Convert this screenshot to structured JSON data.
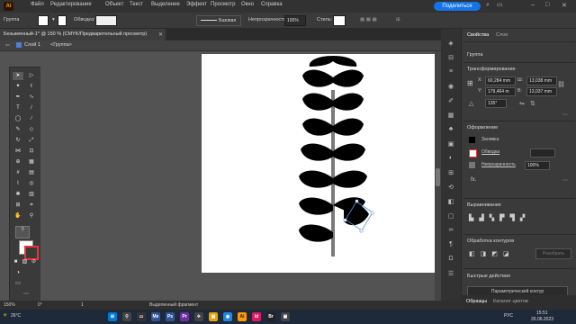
{
  "menubar": {
    "items": [
      "Файл",
      "Редактирование",
      "Объект",
      "Текст",
      "Выделение",
      "Эффект",
      "Просмотр",
      "Окно",
      "Справка"
    ],
    "share_label": "Поделиться"
  },
  "control_bar": {
    "selection_label": "Группа",
    "stroke_label": "Обводка:",
    "stroke_style": "Базовая",
    "opacity_label": "Непрозрачность:",
    "opacity_value": "100%",
    "style_label": "Стиль:"
  },
  "document": {
    "tab_title": "Безымянный-1* @ 150 % (CMYK/Предварительный просмотр)",
    "breadcrumb_layer": "Слой 1",
    "breadcrumb_group": "<Группа>"
  },
  "panel": {
    "tabs": [
      "Свойства",
      "Слои"
    ],
    "selection_type": "Группа",
    "transform_title": "Трансформирование",
    "x_label": "X:",
    "x_value": "60,284 mm",
    "y_label": "Y:",
    "y_value": "179,464 m",
    "w_label": "Ш:",
    "w_value": "13,038 mm",
    "h_label": "В:",
    "h_value": "13,037 mm",
    "angle_value": "135°",
    "appearance_title": "Оформление",
    "fill_label": "Заливка",
    "stroke_label": "Обводка",
    "opacity_label": "Непрозрачность",
    "opacity_value": "100%",
    "fx_label": "fx.",
    "align_title": "Выравнивание",
    "pathfinder_title": "Обработка контуров",
    "expand_label": "Разобрать",
    "quick_actions_title": "Быстрые действия",
    "quick_action_btn": "Параметрический контур"
  },
  "bottom_tabs": [
    "Образцы",
    "Каталог цветов"
  ],
  "status": {
    "zoom": "150%",
    "angle": "0°",
    "page": "1",
    "mode": "Выделенный фрагмент"
  },
  "taskbar": {
    "weather": "26°C",
    "lang": "РУС",
    "time": "15:51",
    "date": "26.06.2023"
  },
  "icons": {
    "app_logo": "illustrator-logo",
    "accent": "#1473e6"
  }
}
